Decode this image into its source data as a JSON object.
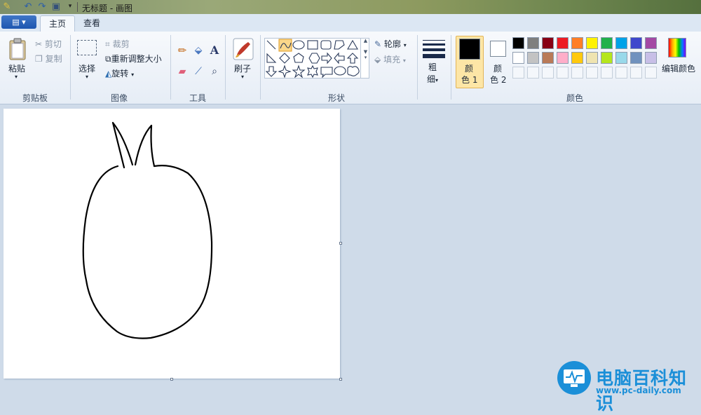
{
  "window": {
    "title": "无标题 - 画图"
  },
  "tabs": {
    "home": "主页",
    "view": "查看"
  },
  "clipboard": {
    "paste": "粘贴",
    "cut": "剪切",
    "copy": "复制",
    "group": "剪贴板"
  },
  "image": {
    "select": "选择",
    "crop": "裁剪",
    "resize": "重新调整大小",
    "rotate": "旋转",
    "group": "图像"
  },
  "tools": {
    "group": "工具"
  },
  "brushes": {
    "label": "刷子"
  },
  "shapes": {
    "outline": "轮廓",
    "fill": "填充",
    "group": "形状"
  },
  "size": {
    "label_1": "粗",
    "label_2": "细"
  },
  "colors": {
    "color1_a": "颜",
    "color1_b": "色 1",
    "color2_a": "颜",
    "color2_b": "色 2",
    "edit": "编辑颜色",
    "group": "颜色",
    "color1": "#000000",
    "color2": "#ffffff",
    "palette_row1": [
      "#000000",
      "#7f7f7f",
      "#880015",
      "#ed1c24",
      "#ff7f27",
      "#fff200",
      "#22b14c",
      "#00a2e8",
      "#3f48cc",
      "#a349a4"
    ],
    "palette_row2": [
      "#ffffff",
      "#c3c3c3",
      "#b97a57",
      "#ffaec9",
      "#ffc90e",
      "#efe4b0",
      "#b5e61d",
      "#99d9ea",
      "#7092be",
      "#c8bfe7"
    ]
  },
  "watermark": {
    "name": "电脑百科知识",
    "url": "www.pc-daily.com"
  }
}
